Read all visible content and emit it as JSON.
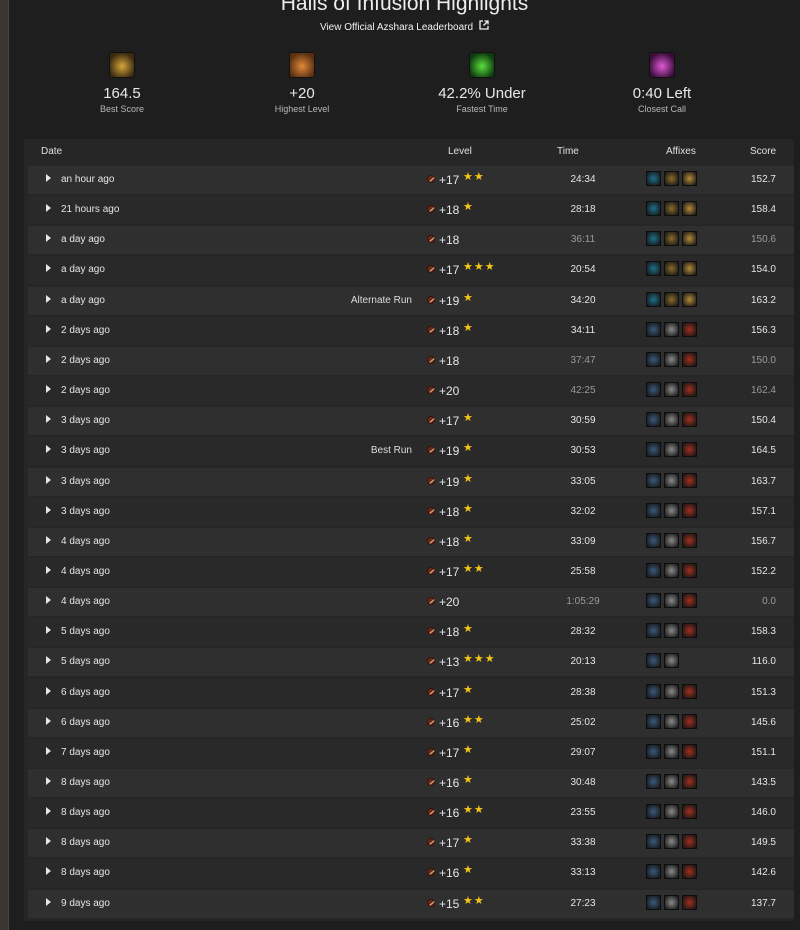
{
  "header": {
    "title": "Halls of Infusion Highlights",
    "leaderboard_link": "View Official Azshara Leaderboard",
    "external_icon": "external-link-icon"
  },
  "stats": [
    {
      "icon": "best-score-icon",
      "value": "164.5",
      "label": "Best Score",
      "colors": [
        "#3a2a10",
        "#d6a53a"
      ]
    },
    {
      "icon": "highest-level-icon",
      "value": "+20",
      "label": "Highest Level",
      "colors": [
        "#5a3010",
        "#e0893a"
      ]
    },
    {
      "icon": "fastest-time-icon",
      "value": "42.2% Under",
      "label": "Fastest Time",
      "colors": [
        "#0e3a10",
        "#5ae03a"
      ]
    },
    {
      "icon": "closest-call-icon",
      "value": "0:40 Left",
      "label": "Closest Call",
      "colors": [
        "#3a0e3a",
        "#e05ad6"
      ]
    }
  ],
  "table": {
    "headers": {
      "date": "Date",
      "level": "Level",
      "time": "Time",
      "affixes": "Affixes",
      "score": "Score"
    },
    "rows": [
      {
        "date": "an hour ago",
        "note": "",
        "level": "+17",
        "stars": "★★",
        "time": "24:34",
        "timed": true,
        "affixes": "set1",
        "score": "152.7"
      },
      {
        "date": "21 hours ago",
        "note": "",
        "level": "+18",
        "stars": "★",
        "time": "28:18",
        "timed": true,
        "affixes": "set1",
        "score": "158.4"
      },
      {
        "date": "a day ago",
        "note": "",
        "level": "+18",
        "stars": "",
        "time": "36:11",
        "timed": false,
        "affixes": "set1",
        "score": "150.6"
      },
      {
        "date": "a day ago",
        "note": "",
        "level": "+17",
        "stars": "★★★",
        "time": "20:54",
        "timed": true,
        "affixes": "set1",
        "score": "154.0"
      },
      {
        "date": "a day ago",
        "note": "Alternate Run",
        "level": "+19",
        "stars": "★",
        "time": "34:20",
        "timed": true,
        "affixes": "set1",
        "score": "163.2"
      },
      {
        "date": "2 days ago",
        "note": "",
        "level": "+18",
        "stars": "★",
        "time": "34:11",
        "timed": true,
        "affixes": "set2",
        "score": "156.3"
      },
      {
        "date": "2 days ago",
        "note": "",
        "level": "+18",
        "stars": "",
        "time": "37:47",
        "timed": false,
        "affixes": "set2",
        "score": "150.0"
      },
      {
        "date": "2 days ago",
        "note": "",
        "level": "+20",
        "stars": "",
        "time": "42:25",
        "timed": false,
        "affixes": "set2",
        "score": "162.4"
      },
      {
        "date": "3 days ago",
        "note": "",
        "level": "+17",
        "stars": "★",
        "time": "30:59",
        "timed": true,
        "affixes": "set2",
        "score": "150.4"
      },
      {
        "date": "3 days ago",
        "note": "Best Run",
        "level": "+19",
        "stars": "★",
        "time": "30:53",
        "timed": true,
        "affixes": "set2",
        "score": "164.5"
      },
      {
        "date": "3 days ago",
        "note": "",
        "level": "+19",
        "stars": "★",
        "time": "33:05",
        "timed": true,
        "affixes": "set2",
        "score": "163.7"
      },
      {
        "date": "3 days ago",
        "note": "",
        "level": "+18",
        "stars": "★",
        "time": "32:02",
        "timed": true,
        "affixes": "set2",
        "score": "157.1"
      },
      {
        "date": "4 days ago",
        "note": "",
        "level": "+18",
        "stars": "★",
        "time": "33:09",
        "timed": true,
        "affixes": "set2",
        "score": "156.7"
      },
      {
        "date": "4 days ago",
        "note": "",
        "level": "+17",
        "stars": "★★",
        "time": "25:58",
        "timed": true,
        "affixes": "set2",
        "score": "152.2"
      },
      {
        "date": "4 days ago",
        "note": "",
        "level": "+20",
        "stars": "",
        "time": "1:05:29",
        "timed": false,
        "affixes": "set2",
        "score": "0.0"
      },
      {
        "date": "5 days ago",
        "note": "",
        "level": "+18",
        "stars": "★",
        "time": "28:32",
        "timed": true,
        "affixes": "set2",
        "score": "158.3"
      },
      {
        "date": "5 days ago",
        "note": "",
        "level": "+13",
        "stars": "★★★",
        "time": "20:13",
        "timed": true,
        "affixes": "set3",
        "score": "116.0"
      },
      {
        "date": "6 days ago",
        "note": "",
        "level": "+17",
        "stars": "★",
        "time": "28:38",
        "timed": true,
        "affixes": "set2",
        "score": "151.3"
      },
      {
        "date": "6 days ago",
        "note": "",
        "level": "+16",
        "stars": "★★",
        "time": "25:02",
        "timed": true,
        "affixes": "set2",
        "score": "145.6"
      },
      {
        "date": "7 days ago",
        "note": "",
        "level": "+17",
        "stars": "★",
        "time": "29:07",
        "timed": true,
        "affixes": "set2",
        "score": "151.1"
      },
      {
        "date": "8 days ago",
        "note": "",
        "level": "+16",
        "stars": "★",
        "time": "30:48",
        "timed": true,
        "affixes": "set2",
        "score": "143.5"
      },
      {
        "date": "8 days ago",
        "note": "",
        "level": "+16",
        "stars": "★★",
        "time": "23:55",
        "timed": true,
        "affixes": "set2",
        "score": "146.0"
      },
      {
        "date": "8 days ago",
        "note": "",
        "level": "+17",
        "stars": "★",
        "time": "33:38",
        "timed": true,
        "affixes": "set2",
        "score": "149.5"
      },
      {
        "date": "8 days ago",
        "note": "",
        "level": "+16",
        "stars": "★",
        "time": "33:13",
        "timed": true,
        "affixes": "set2",
        "score": "142.6"
      },
      {
        "date": "9 days ago",
        "note": "",
        "level": "+15",
        "stars": "★★",
        "time": "27:23",
        "timed": true,
        "affixes": "set2",
        "score": "137.7"
      }
    ]
  },
  "affix_sets": {
    "set1": [
      {
        "icon": "spiteful-affix-icon",
        "color": "#1f6f8a"
      },
      {
        "icon": "quaking-affix-icon",
        "color": "#8a6a2a"
      },
      {
        "icon": "tyrannical-affix-icon",
        "color": "#b58a3a"
      }
    ],
    "set2": [
      {
        "icon": "storming-affix-icon",
        "color": "#3a5a7a"
      },
      {
        "icon": "bolstering-affix-icon",
        "color": "#8a8a8a"
      },
      {
        "icon": "fortified-affix-icon",
        "color": "#a03020"
      }
    ],
    "set3": [
      {
        "icon": "storming-affix-icon",
        "color": "#3a5a7a"
      },
      {
        "icon": "bolstering-affix-icon",
        "color": "#8a8a8a"
      }
    ]
  },
  "level_icon": "keystone-icon",
  "row_chevron": "chevron-right-icon",
  "colors": {
    "star": "#f5c518",
    "dim_text": "#9a9a9a"
  }
}
